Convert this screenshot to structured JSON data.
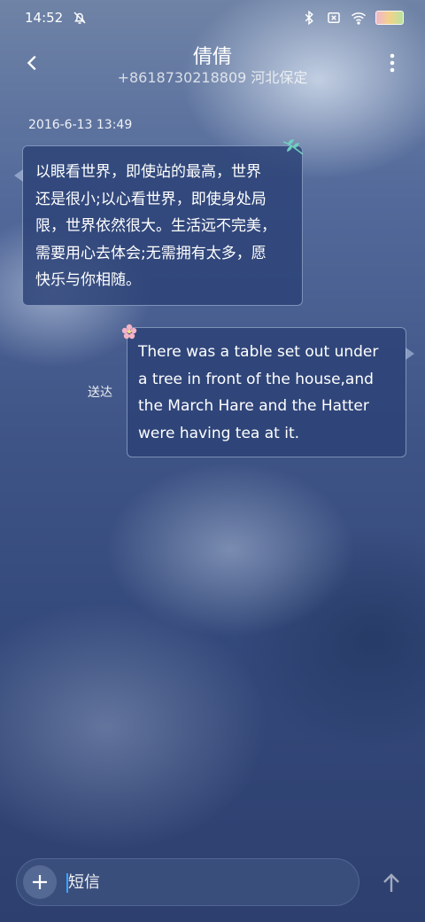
{
  "status_bar": {
    "time": "14:52",
    "icons": [
      "alarm-off-icon",
      "bluetooth-icon",
      "sim-x-icon",
      "wifi-icon",
      "battery-icon"
    ]
  },
  "header": {
    "contact_name": "倩倩",
    "contact_subtitle": "+8618730218809 河北保定"
  },
  "messages": [
    {
      "direction": "incoming",
      "timestamp": "2016-6-13 13:49",
      "lines": [
        "以眼看世界，即使站的最高，世界",
        "还是很小;以心看世界，即使身处局",
        "限，世界依然很大。生活远不完美，",
        "需要用心去体会;无需拥有太多，愿",
        "快乐与你相随。"
      ]
    },
    {
      "direction": "outgoing",
      "status": "送达",
      "lines": [
        "There was a table set out under",
        "a tree in front of the house,and",
        "the March Hare and the Hatter",
        "were having tea at it."
      ]
    }
  ],
  "compose": {
    "placeholder": "短信"
  },
  "colors": {
    "bubble_bg": "#2c4276",
    "caret": "#3aa3ff"
  }
}
